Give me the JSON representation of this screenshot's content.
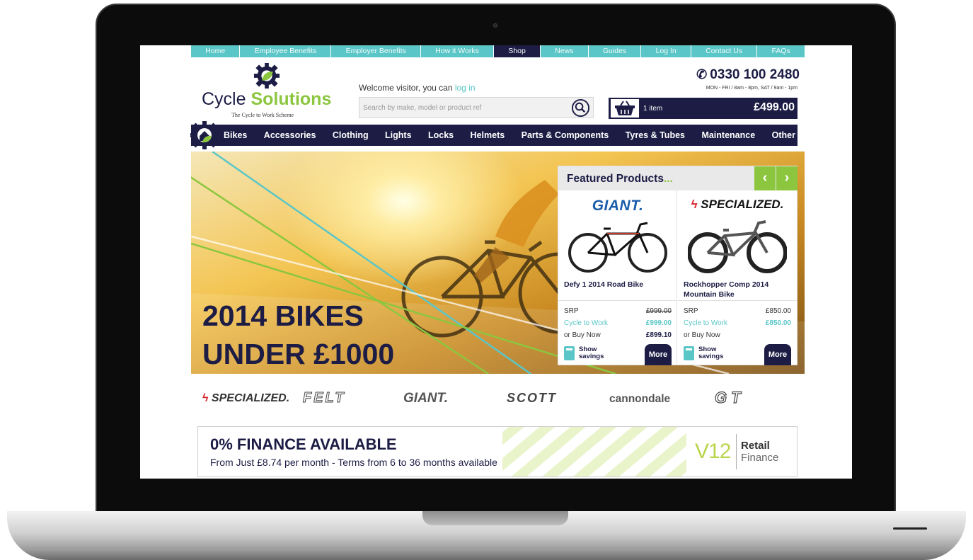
{
  "topnav": {
    "items": [
      "Home",
      "Employee Benefits",
      "Employer Benefits",
      "How it Works",
      "Shop",
      "News",
      "Guides",
      "Log In",
      "Contact Us",
      "FAQs"
    ],
    "active": "Shop"
  },
  "header": {
    "logo_text_1": "Cycle",
    "logo_text_2": "Solutions",
    "logo_tagline": "The Cycle to Work Scheme",
    "welcome_text": "Welcome visitor, you can",
    "login_link": "log in",
    "search_placeholder": "Search by make, model or product ref",
    "phone": "0330 100 2480",
    "hours": "MON - FRI / 8am - 8pm, SAT / 9am - 1pm",
    "basket_count": "1 item",
    "basket_total": "£499.00"
  },
  "mainnav": {
    "items": [
      "Bikes",
      "Accessories",
      "Clothing",
      "Lights",
      "Locks",
      "Helmets",
      "Parts & Components",
      "Tyres & Tubes",
      "Maintenance",
      "Other"
    ]
  },
  "hero": {
    "line1": "2014 BIKES",
    "line2": "UNDER £1000"
  },
  "featured": {
    "title": "Featured Products",
    "title_suffix": "...",
    "prev_icon": "‹",
    "next_icon": "›",
    "products": [
      {
        "brand": "GIANT.",
        "name": "Defy 1 2014 Road Bike",
        "srp_label": "SRP",
        "srp": "£999.00",
        "c2w_label": "Cycle to Work",
        "c2w": "£999.00",
        "buy_label": "or Buy Now",
        "buy": "£899.10",
        "savings_label": "Show savings",
        "more_label": "More"
      },
      {
        "brand": "SPECIALIZED.",
        "name": "Rockhopper Comp 2014 Mountain Bike",
        "srp_label": "SRP",
        "srp": "£850.00",
        "c2w_label": "Cycle to Work",
        "c2w": "£850.00",
        "buy_label": "or Buy Now",
        "buy": "",
        "savings_label": "Show savings",
        "more_label": "More"
      }
    ]
  },
  "brands": {
    "specialized": "SPECIALIZED.",
    "felt": "FELT",
    "giant": "GIANT.",
    "scott": "SCOTT",
    "cannondale": "cannondale",
    "gt": "GT"
  },
  "finance": {
    "title": "0% FINANCE AVAILABLE",
    "subtitle": "From Just £8.74 per month - Terms from 6 to 36 months available",
    "v12": "V12",
    "retail": "Retail",
    "finance_word": "Finance"
  },
  "colors": {
    "navy": "#1c1c45",
    "teal": "#5bc6c7",
    "green": "#8cc63f"
  }
}
